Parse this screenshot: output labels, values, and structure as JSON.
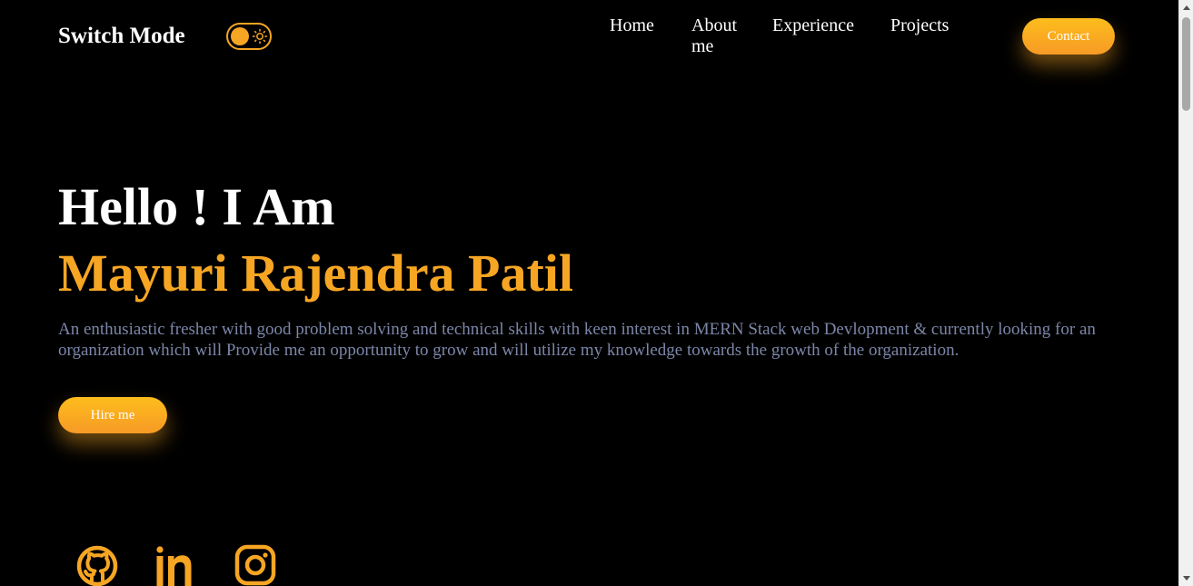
{
  "header": {
    "brand": "Switch Mode",
    "nav": {
      "home": "Home",
      "about": "About me",
      "experience": "Experience",
      "projects": "Projects"
    },
    "contact_label": "Contact"
  },
  "hero": {
    "greeting": "Hello ! I Am",
    "name": "Mayuri Rajendra Patil",
    "description": "An enthusiastic fresher with good problem solving and technical skills with keen interest in MERN Stack web Devlopment & currently looking for an organization which will Provide me an opportunity to grow and will utilize my knowledge towards the growth of the organization.",
    "hire_label": "Hire me"
  },
  "social": {
    "icons": [
      "github-icon",
      "linkedin-icon",
      "instagram-icon"
    ]
  },
  "theme": {
    "accent": "#f6a623",
    "background": "#000000",
    "text": "#ffffff",
    "muted_text": "#7c86a8"
  }
}
